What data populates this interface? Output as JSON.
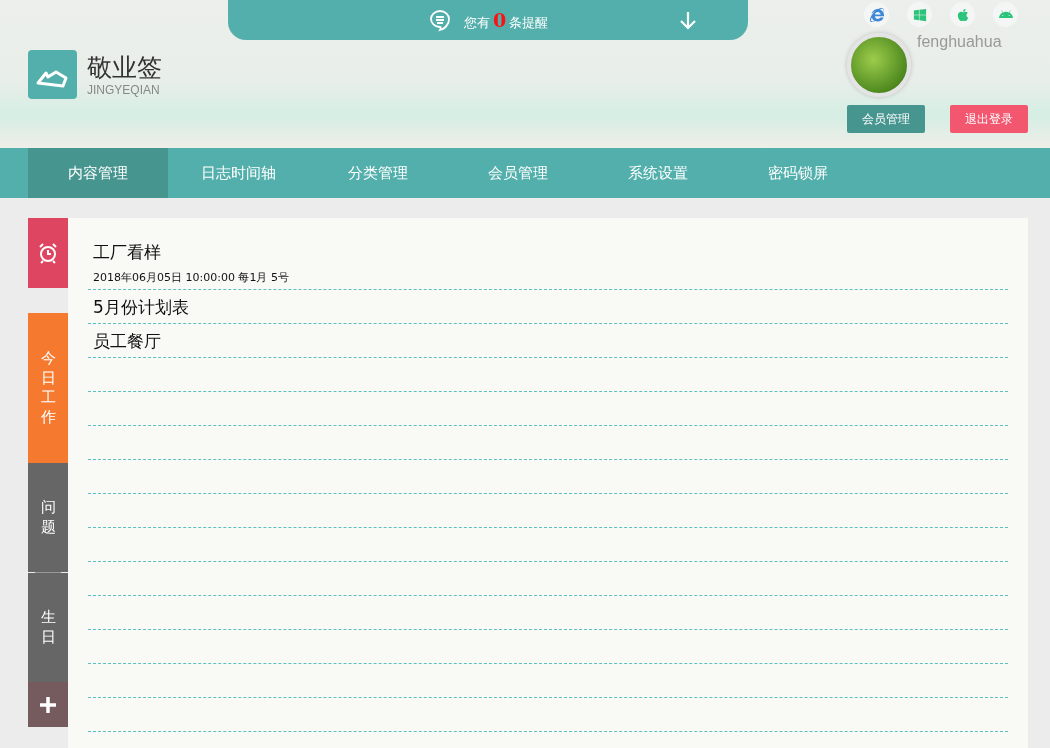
{
  "notice": {
    "prefix": "您有",
    "count": "0",
    "suffix": "条提醒"
  },
  "logo": {
    "title": "敬业签",
    "subtitle": "JINGYEQIAN"
  },
  "user": {
    "name": "fenghuahua"
  },
  "header_buttons": [
    {
      "label": "会员管理",
      "kind": "primary"
    },
    {
      "label": "退出登录",
      "kind": "danger"
    }
  ],
  "nav": [
    {
      "label": "内容管理",
      "selected": true
    },
    {
      "label": "日志时间轴",
      "selected": false
    },
    {
      "label": "分类管理",
      "selected": false
    },
    {
      "label": "会员管理",
      "selected": false
    },
    {
      "label": "系统设置",
      "selected": false
    },
    {
      "label": "密码锁屏",
      "selected": false
    }
  ],
  "sidebar_tabs": [
    {
      "label": "今日工作",
      "selected": true
    },
    {
      "label": "问题",
      "selected": false
    },
    {
      "label": "生日",
      "selected": false
    }
  ],
  "notes": [
    {
      "title": "工厂看样",
      "meta": "2018年06月05日 10:00:00 每1月 5号"
    },
    {
      "title": "5月份计划表"
    },
    {
      "title": "员工餐厅"
    }
  ]
}
